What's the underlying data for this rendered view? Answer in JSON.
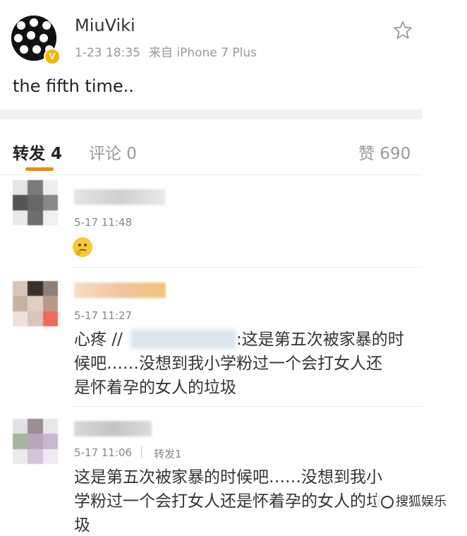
{
  "post": {
    "username": "MiuViki",
    "date": "1-23 18:35",
    "source": "来自 iPhone 7 Plus",
    "badge": "V",
    "text": "the fifth time.."
  },
  "tabs": {
    "repost": "转发 4",
    "comment": "评论 0",
    "like": "赞 690"
  },
  "reposts": [
    {
      "time": "5-17 11:48",
      "content": ""
    },
    {
      "time": "5-17 11:27",
      "prefix": "心疼 //",
      "line1": ":这是第五次被家暴的时",
      "line2": "候吧……没想到我小学粉过一个会打女人还",
      "line3": "是怀着孕的女人的垃圾"
    },
    {
      "time": "5-17 11:06",
      "tag": "转发1",
      "line1": "这是第五次被家暴的时候吧……没想到我小",
      "line2": "学粉过一个会打女人还是怀着孕的女人的垃",
      "line3": "圾"
    }
  ],
  "watermark": "搜狐娱乐",
  "colors": {
    "accent": "#f08a00",
    "muted": "#999999",
    "badge": "#f5b400"
  }
}
